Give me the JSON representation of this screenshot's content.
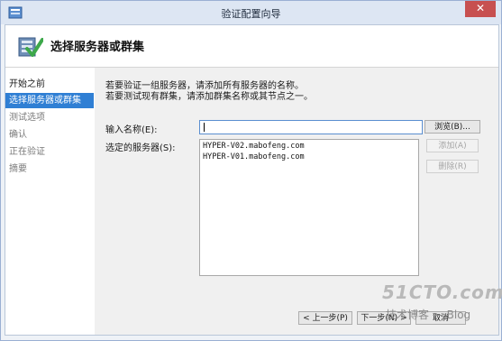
{
  "window": {
    "title": "验证配置向导",
    "close_glyph": "✕"
  },
  "header": {
    "title": "选择服务器或群集",
    "icon": "wizard-check-icon"
  },
  "nav": {
    "items": [
      {
        "label": "开始之前"
      },
      {
        "label": "选择服务器或群集"
      },
      {
        "label": "测试选项"
      },
      {
        "label": "确认"
      },
      {
        "label": "正在验证"
      },
      {
        "label": "摘要"
      }
    ],
    "active_index": 1
  },
  "main": {
    "description": [
      "若要验证一组服务器，请添加所有服务器的名称。",
      "若要测试现有群集，请添加群集名称或其节点之一。"
    ],
    "name_label": "输入名称(E):",
    "name_value": "",
    "browse_label": "浏览(B)...",
    "selected_label": "选定的服务器(S):",
    "servers": [
      "HYPER-V02.mabofeng.com",
      "HYPER-V01.mabofeng.com"
    ],
    "add_label": "添加(A)",
    "remove_label": "删除(R)"
  },
  "footer": {
    "back_label": "< 上一步(P)",
    "next_label": "下一步(N) >",
    "cancel_label": "取消"
  },
  "watermark": {
    "site": "51CTO.com",
    "blog": "技术博客 — Blog"
  },
  "colors": {
    "accent": "#2f7fd4",
    "close": "#c75050",
    "titlebar": "#dde6f3"
  }
}
